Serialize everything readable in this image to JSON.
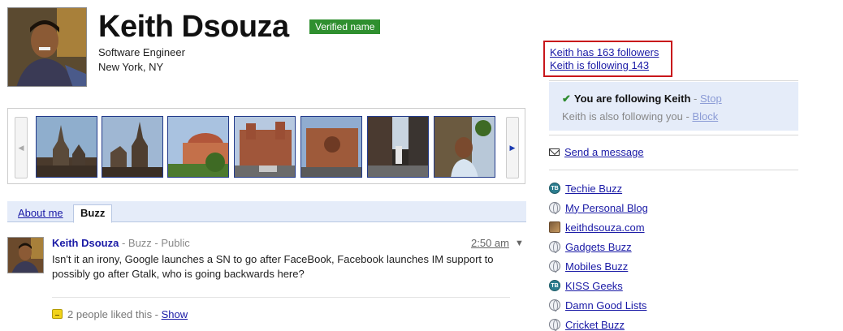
{
  "profile": {
    "name": "Keith Dsouza",
    "verified_badge": "Verified name",
    "job": "Software Engineer",
    "location": "New York, NY"
  },
  "photos": {
    "prev_arrow": "◀",
    "next_arrow": "▶",
    "count_visible": 7
  },
  "tabs": [
    {
      "label": "About me",
      "active": false
    },
    {
      "label": "Buzz",
      "active": true
    }
  ],
  "post": {
    "author": "Keith Dsouza",
    "meta": " - Buzz - Public",
    "time": "2:50 am",
    "menu": "▼",
    "body": "Isn't it an irony, Google launches a SN to go after FaceBook, Facebook launches IM support to possibly go after Gtalk, who is going backwards here?",
    "likes_text": "2 people liked this - ",
    "likes_show": "Show"
  },
  "follow": {
    "followers": "Keith has 163 followers",
    "following": "Keith is following 143",
    "you_following": "You are following Keith",
    "stop_sep": " - ",
    "stop": "Stop",
    "also_following": "Keith is also following you - ",
    "block": "Block",
    "send_message": "Send a message"
  },
  "links": [
    {
      "label": "Techie Buzz",
      "icon": "tb-icon"
    },
    {
      "label": "My Personal Blog",
      "icon": "globe-icon"
    },
    {
      "label": "keithdsouza.com",
      "icon": "photo-icon"
    },
    {
      "label": "Gadgets Buzz",
      "icon": "globe-icon"
    },
    {
      "label": "Mobiles Buzz",
      "icon": "globe-icon"
    },
    {
      "label": "KISS Geeks",
      "icon": "tb-icon"
    },
    {
      "label": "Damn Good Lists",
      "icon": "globe-icon"
    },
    {
      "label": "Cricket Buzz",
      "icon": "globe-icon"
    }
  ],
  "colors": {
    "link": "#1a1aa6",
    "verified_bg": "#2f8f2f",
    "highlight_border": "#c8161b",
    "panel_bg": "#e5ecf9"
  }
}
